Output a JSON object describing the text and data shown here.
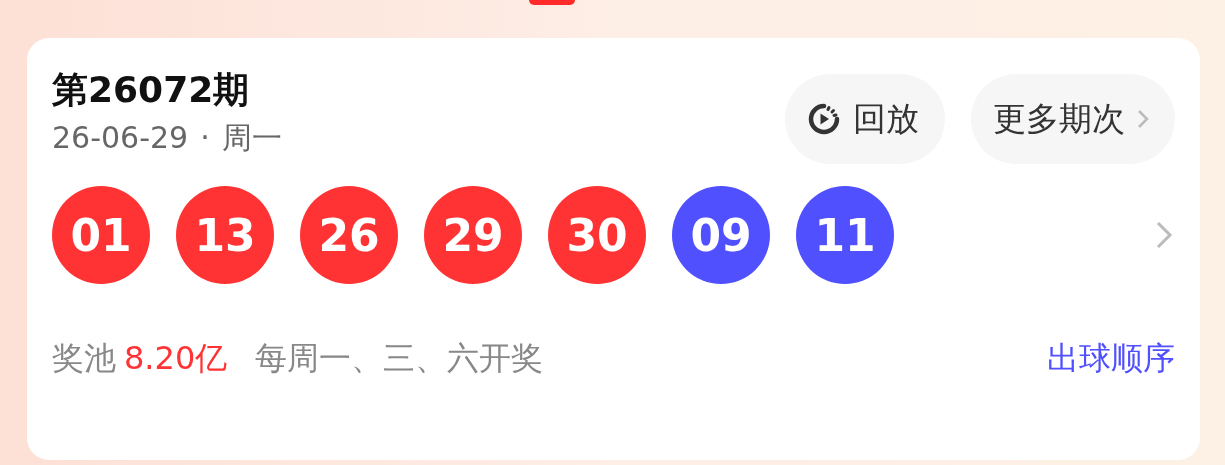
{
  "draw": {
    "title": "第26072期",
    "date": "26-06-29",
    "separator": "·",
    "weekday": "周一"
  },
  "buttons": [
    {
      "kind": "replay",
      "label": "回放"
    },
    {
      "kind": "more",
      "label": "更多期次"
    }
  ],
  "balls": [
    {
      "number": "01",
      "color": "#ff3333"
    },
    {
      "number": "13",
      "color": "#ff3333"
    },
    {
      "number": "26",
      "color": "#ff3333"
    },
    {
      "number": "29",
      "color": "#ff3333"
    },
    {
      "number": "30",
      "color": "#ff3333"
    },
    {
      "number": "09",
      "color": "#5050ff"
    },
    {
      "number": "11",
      "color": "#5050ff"
    }
  ],
  "footer": {
    "pool_label": "奖池",
    "pool_amount": "8.20亿",
    "schedule": "每周一、三、六开奖",
    "link": "出球顺序"
  }
}
